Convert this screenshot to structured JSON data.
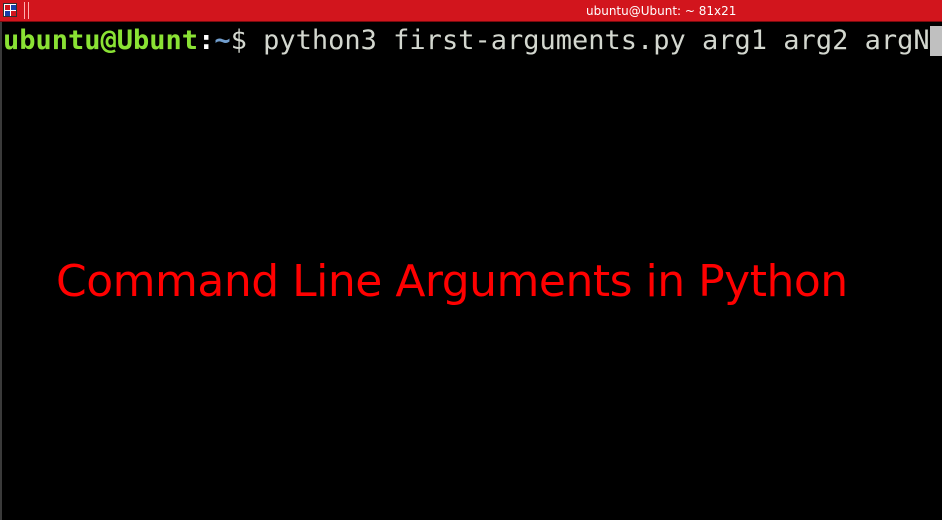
{
  "window": {
    "title": "ubuntu@Ubunt: ~ 81x21",
    "titlebar_color": "#d2151d",
    "icon": "terminal-app-icon"
  },
  "terminal": {
    "prompt": {
      "user_host": "ubuntu@Ubunt",
      "colon": ":",
      "path": "~",
      "symbol": "$"
    },
    "command": " python3 first-arguments.py arg1 arg2 argN",
    "colors": {
      "user_host": "#8ae234",
      "path": "#729fcf",
      "text": "#d3d7cf",
      "background": "#000000",
      "cursor": "#c0c0c0"
    }
  },
  "overlay": {
    "title": "Command Line Arguments in Python",
    "color": "#ff0000"
  }
}
